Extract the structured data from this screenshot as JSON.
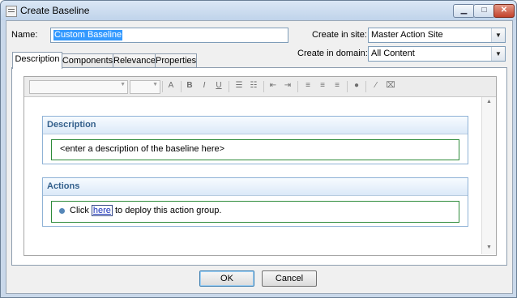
{
  "window": {
    "title": "Create Baseline",
    "controls": [
      "minimize",
      "maximize",
      "close"
    ]
  },
  "form": {
    "name_label": "Name:",
    "name_value": "Custom Baseline",
    "site_label": "Create in site:",
    "site_value": "Master Action Site",
    "domain_label": "Create in domain:",
    "domain_value": "All Content"
  },
  "tabs": [
    {
      "label": "Description",
      "active": true
    },
    {
      "label": "Components",
      "active": false
    },
    {
      "label": "Relevance",
      "active": false
    },
    {
      "label": "Properties",
      "active": false
    }
  ],
  "toolbar": {
    "icons": [
      "font-size-icon",
      "bold-icon",
      "italic-icon",
      "underline-icon",
      "ordered-list-icon",
      "unordered-list-icon",
      "outdent-icon",
      "indent-icon",
      "align-left-icon",
      "align-center-icon",
      "align-right-icon",
      "insert-link-icon",
      "insert-html-icon",
      "remove-format-icon"
    ]
  },
  "editor": {
    "description_header": "Description",
    "description_placeholder": "<enter a description of the baseline here>",
    "actions_header": "Actions",
    "action_prefix": "Click ",
    "action_link": "here",
    "action_suffix": " to deploy this action group."
  },
  "buttons": {
    "ok": "OK",
    "cancel": "Cancel"
  },
  "colors": {
    "section_header_text": "#34608c",
    "section_border": "#8fb2d6",
    "field_border": "#2e8b3a",
    "link": "#1830b8"
  }
}
